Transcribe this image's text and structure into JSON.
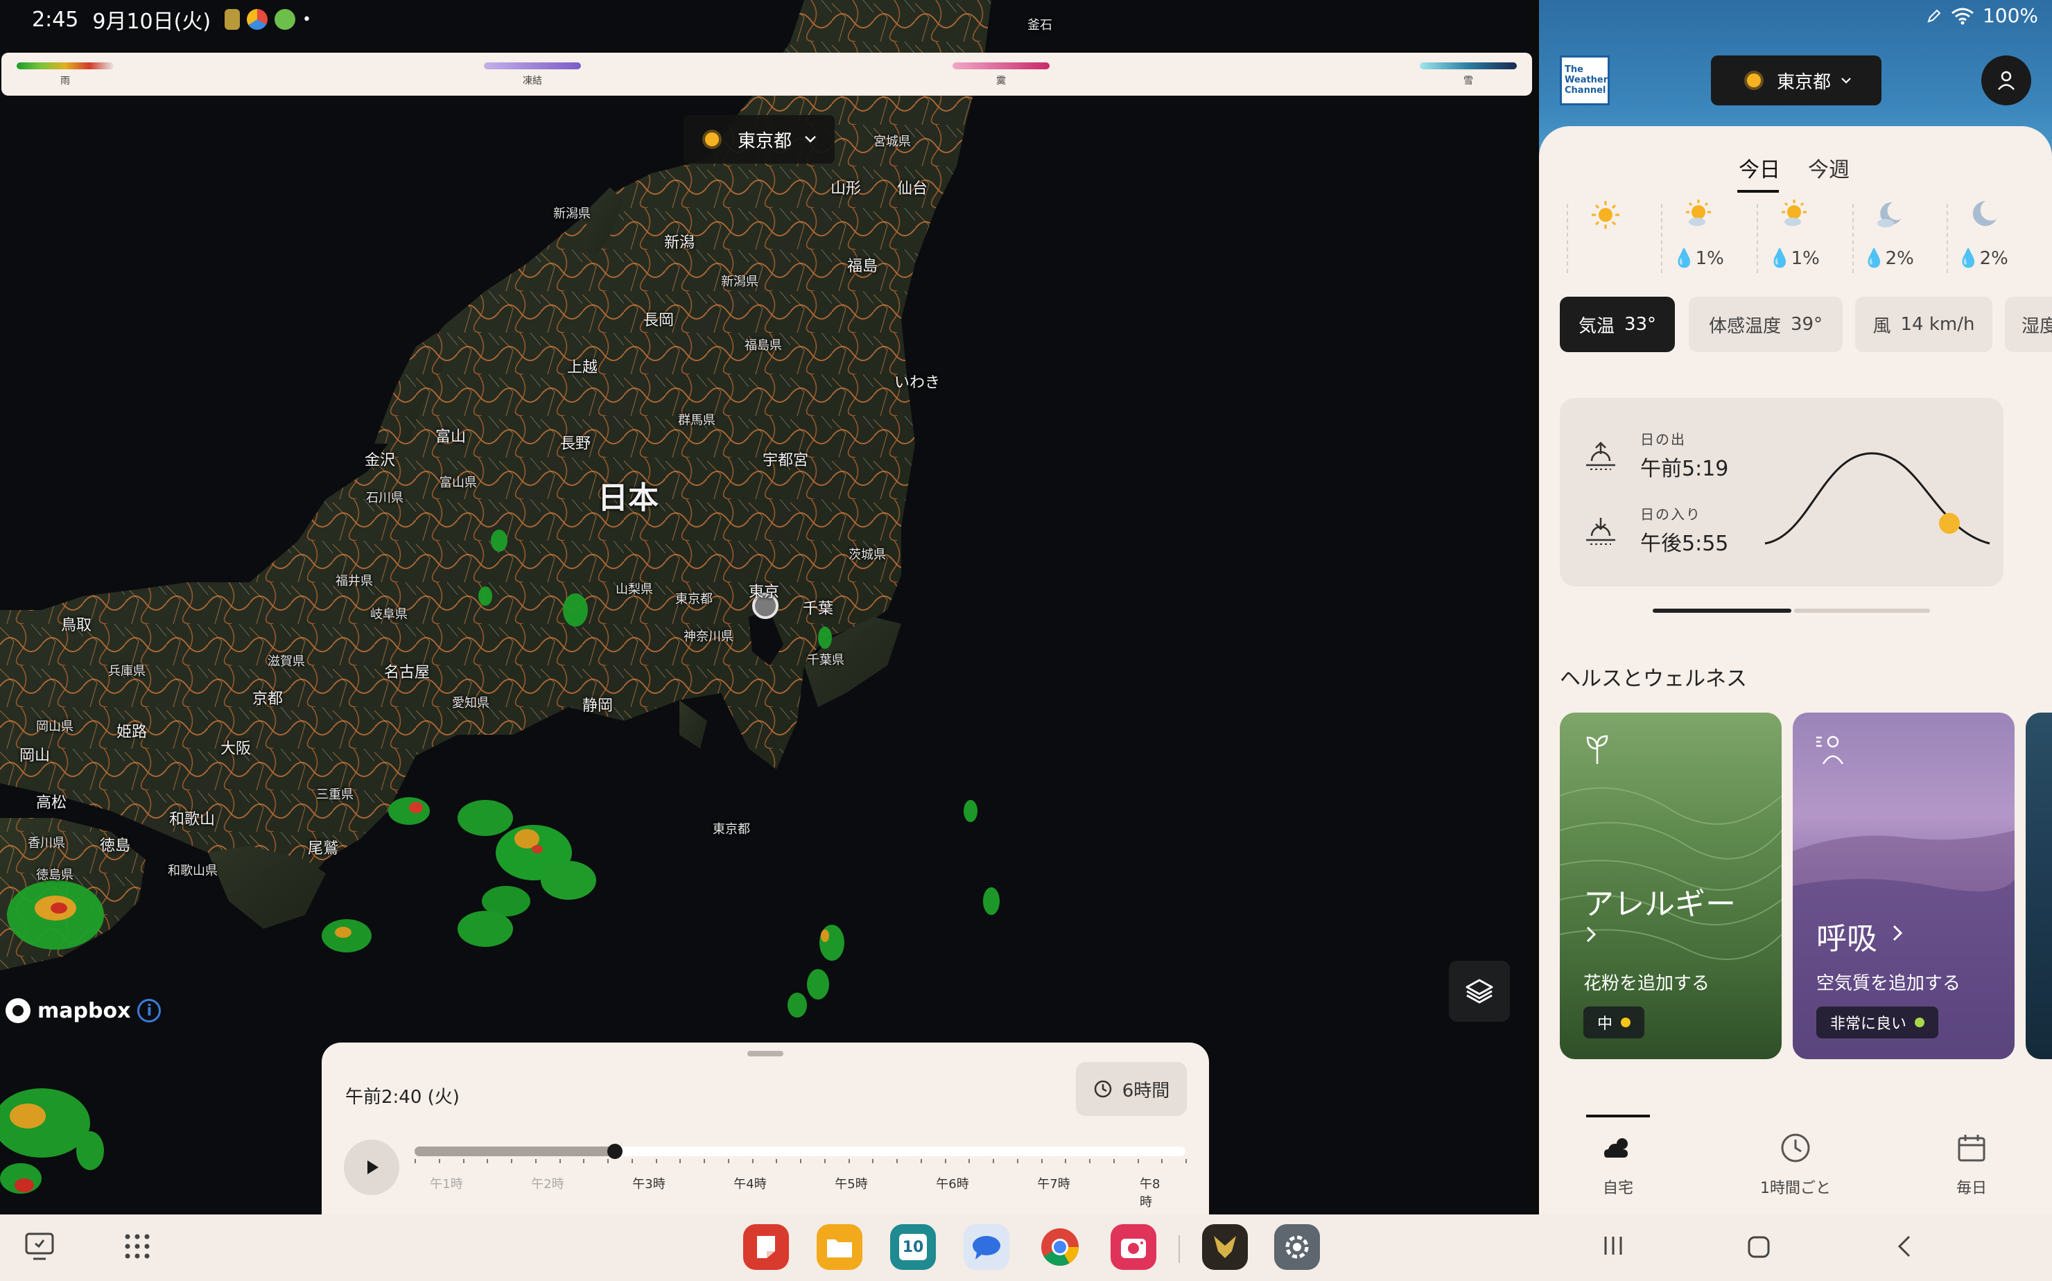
{
  "status_bar": {
    "time": "2:45",
    "date": "9月10日(火)",
    "battery": "100%"
  },
  "legend": {
    "rain": "雨",
    "freeze": "凍結",
    "mix": "霙",
    "snow": "雪"
  },
  "map": {
    "location_chip": "東京都",
    "labels": {
      "kamaishi": "釜石",
      "miyagi": "宮城県",
      "yamagata": "山形",
      "sendai": "仙台",
      "niigata_pref_island": "新潟県",
      "niigata": "新潟",
      "niigata_pref": "新潟県",
      "fukushima": "福島",
      "nagaoka": "長岡",
      "fukushima_pref": "福島県",
      "iwaki": "いわき",
      "joetsu": "上越",
      "gunma": "群馬県",
      "toyama": "富山",
      "nagano": "長野",
      "kanazawa": "金沢",
      "utsunomiya": "宇都宮",
      "toyama_pref": "富山県",
      "ishikawa": "石川県",
      "nihon": "日本",
      "ibaraki": "茨城県",
      "fukui": "福井県",
      "yamanashi": "山梨県",
      "tokyo_pref": "東京都",
      "tokyo": "東京",
      "chiba": "千葉",
      "gifu": "岐阜県",
      "tottori": "鳥取",
      "kanagawa": "神奈川県",
      "chiba_pref": "千葉県",
      "hyogo": "兵庫県",
      "shiga": "滋賀県",
      "nagoya": "名古屋",
      "kyoto": "京都",
      "aichi": "愛知県",
      "shizuoka": "静岡",
      "okayama_pref": "岡山県",
      "himeji": "姫路",
      "okayama": "岡山",
      "osaka": "大阪",
      "takamatsu": "高松",
      "mie": "三重県",
      "wakayama": "和歌山",
      "kagawa": "香川県",
      "tokushima": "徳島",
      "owase": "尾鷲",
      "tokyo_islands": "東京都",
      "tokushima_pref": "徳島県",
      "wakayama_pref": "和歌山県"
    },
    "attribution": "mapbox"
  },
  "timeline": {
    "current_time": "午前2:40 (火)",
    "range_label": "6時間",
    "progress": 0.26,
    "hours": [
      "午1時",
      "午2時",
      "午3時",
      "午4時",
      "午5時",
      "午6時",
      "午7時",
      "午8時"
    ]
  },
  "weather": {
    "logo_text": [
      "The",
      "Weather",
      "Channel"
    ],
    "location": "東京都",
    "tabs": [
      "今日",
      "今週"
    ],
    "hourly": [
      {
        "icon": "partly-cloudy-icon",
        "precip": ""
      },
      {
        "icon": "sun-icon",
        "precip": ""
      },
      {
        "icon": "sun-cloud-icon",
        "precip": "1%"
      },
      {
        "icon": "sun-cloud-icon",
        "precip": "1%"
      },
      {
        "icon": "moon-cloud-icon",
        "precip": "2%"
      },
      {
        "icon": "moon-icon",
        "precip": "2%"
      }
    ],
    "chips": [
      {
        "label": "気温",
        "value": "33°"
      },
      {
        "label": "体感温度",
        "value": "39°"
      },
      {
        "label": "風",
        "value": "14 km/h"
      },
      {
        "label": "湿度",
        "value": ""
      }
    ],
    "sun": {
      "sunrise_label": "日の出",
      "sunrise": "午前5:19",
      "sunset_label": "日の入り",
      "sunset": "午後5:55"
    },
    "health_title": "ヘルスとウェルネス",
    "cards": [
      {
        "title": "アレルギー",
        "subtitle": "花粉を追加する",
        "badge": "中",
        "badge_color": "#f5c518"
      },
      {
        "title": "呼吸",
        "subtitle": "空気質を追加する",
        "badge": "非常に良い",
        "badge_color": "#a6d84a"
      }
    ],
    "bottom_nav": [
      "自宅",
      "1時間ごと",
      "毎日"
    ]
  },
  "taskbar": {
    "calendar_day": "10"
  }
}
